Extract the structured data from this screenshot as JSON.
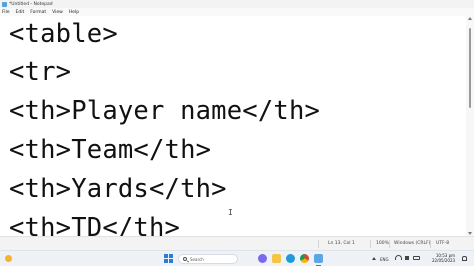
{
  "window": {
    "title": "*Untitled - Notepad"
  },
  "menu": [
    "File",
    "Edit",
    "Format",
    "View",
    "Help"
  ],
  "editor": {
    "lines": [
      "<table>",
      "<tr>",
      "<th>Player name</th>",
      "<th>Team</th>",
      "<th>Yards</th>",
      "<th>TD</th>"
    ]
  },
  "status": {
    "position": "Ln 13, Col 1",
    "zoom": "100%",
    "line_ending": "Windows (CRLF)",
    "encoding": "UTF-8"
  },
  "taskbar": {
    "search_placeholder": "Search",
    "language": "ENG",
    "time": "10:53 pm",
    "date": "22/05/2023"
  },
  "icons": {
    "app": "notepad-icon",
    "start": "windows-start-icon",
    "search": "search-icon"
  },
  "colors": {
    "accent": "#2a7fd4"
  }
}
